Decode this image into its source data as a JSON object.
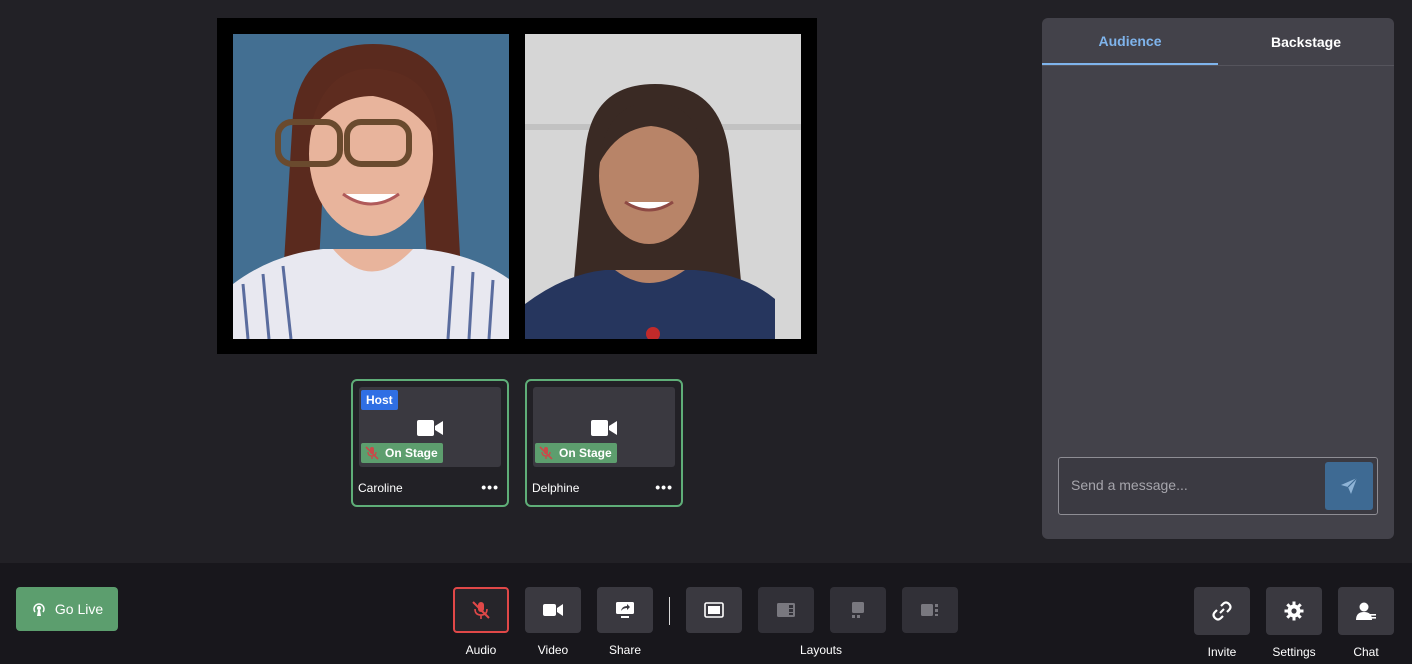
{
  "participants": [
    {
      "name": "Caroline",
      "badge": "Host",
      "status": "On Stage",
      "menu": "•••"
    },
    {
      "name": "Delphine",
      "badge": "",
      "status": "On Stage",
      "menu": "•••"
    }
  ],
  "chat": {
    "tabs": [
      "Audience",
      "Backstage"
    ],
    "active_tab": "Audience",
    "placeholder": "Send a message..."
  },
  "controls": {
    "go_live": "Go Live",
    "audio": "Audio",
    "video": "Video",
    "share": "Share",
    "layouts": "Layouts",
    "invite": "Invite",
    "settings": "Settings",
    "chat": "Chat"
  },
  "colors": {
    "accent_green": "#5c9e6e",
    "host_blue": "#2f6fe4",
    "active_tab": "#7fb4ec",
    "mute_red": "#e04848"
  },
  "icons": [
    "camera-icon",
    "mic-off-icon",
    "send-icon",
    "broadcast-icon",
    "share-screen-icon",
    "layout-icon",
    "link-icon",
    "gear-icon",
    "person-icon",
    "more-icon"
  ]
}
